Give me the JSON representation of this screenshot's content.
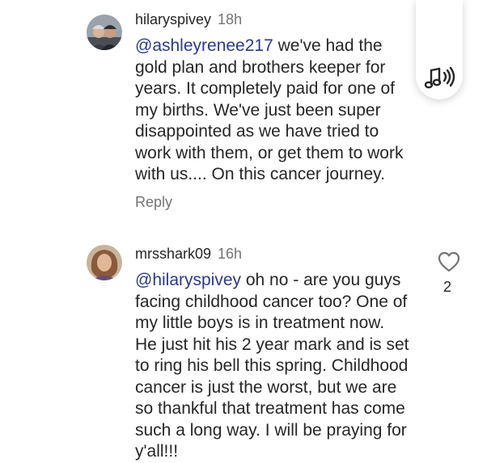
{
  "comments": [
    {
      "username": "hilaryspivey",
      "time": "18h",
      "mention": "@ashleyrenee217",
      "text_lines": [
        " we've had the",
        "gold plan and brothers keeper for",
        "years. It completely paid for one of",
        "my births. We've just been super",
        "disappointed as we have tried to",
        "work with them, or get them to work",
        "with us.... On this cancer journey."
      ],
      "reply_label": "Reply"
    },
    {
      "username": "mrsshark09",
      "time": "16h",
      "mention": "@hilaryspivey",
      "text_lines": [
        " oh no - are you guys",
        "facing childhood cancer too? One of",
        "my little boys is in treatment now.",
        "He just hit his 2 year mark and is set",
        "to ring his bell this spring. Childhood",
        "cancer is just the worst, but we are",
        "so thankful that treatment has come",
        "such a long way. I will be praying for",
        "y'all!!!"
      ],
      "like_count": "2"
    }
  ],
  "icons": {
    "audio": "audio-wave-icon",
    "like": "heart-outline-icon"
  },
  "colors": {
    "text": "#262626",
    "secondary": "#737373",
    "mention": "#2a3a8c"
  }
}
